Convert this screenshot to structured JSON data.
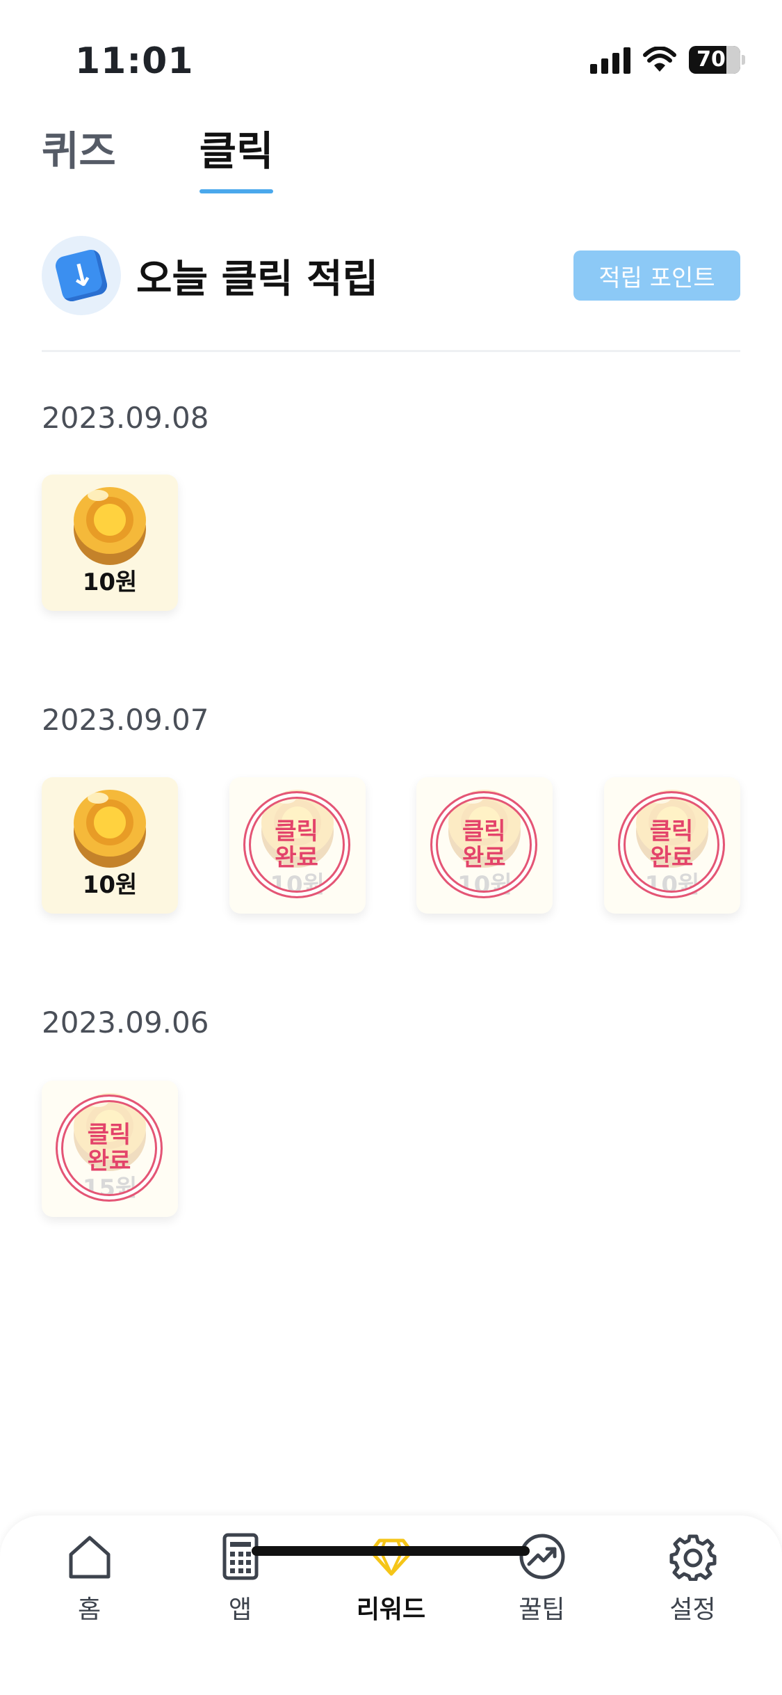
{
  "status_bar": {
    "time": "11:01",
    "battery": "70"
  },
  "tabs": [
    {
      "label": "퀴즈",
      "active": false
    },
    {
      "label": "클릭",
      "active": true
    }
  ],
  "header": {
    "title": "오늘 클릭 적립",
    "points_button": "적립 포인트",
    "icon": "download-arrow-icon"
  },
  "groups": [
    {
      "date": "2023.09.08",
      "items": [
        {
          "amount": "10원",
          "status": "available"
        }
      ]
    },
    {
      "date": "2023.09.07",
      "items": [
        {
          "amount": "10원",
          "status": "available"
        },
        {
          "amount": "10원",
          "status": "done"
        },
        {
          "amount": "10원",
          "status": "done"
        },
        {
          "amount": "10원",
          "status": "done"
        }
      ]
    },
    {
      "date": "2023.09.06",
      "items": [
        {
          "amount": "15원",
          "status": "done"
        }
      ]
    }
  ],
  "stamp": {
    "line1": "클릭",
    "line2": "완료"
  },
  "nav": [
    {
      "label": "홈",
      "icon": "home-icon",
      "active": false
    },
    {
      "label": "앱",
      "icon": "app-grid-icon",
      "active": false
    },
    {
      "label": "리워드",
      "icon": "diamond-icon",
      "active": true
    },
    {
      "label": "꿀팁",
      "icon": "trend-up-icon",
      "active": false
    },
    {
      "label": "설정",
      "icon": "gear-icon",
      "active": false
    }
  ],
  "colors": {
    "accent": "#4aa8ec",
    "points_button": "#8cc9f6",
    "stamp": "#e3436a",
    "reward_active": "#f5c518"
  }
}
